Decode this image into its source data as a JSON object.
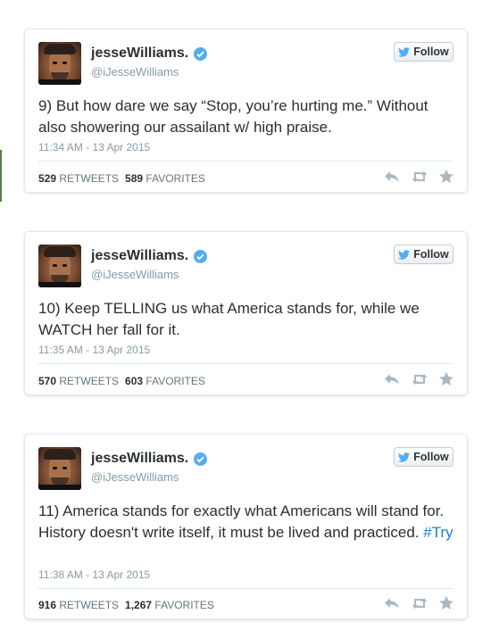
{
  "tweets": [
    {
      "display_name": "jesseWilliams.",
      "handle": "@iJesseWilliams",
      "follow_label": "Follow",
      "text": "9) But how dare we say “Stop, you’re hurting me.” Without also showering our assailant w/ high praise.",
      "hashtag": "",
      "timestamp": "11:34 AM - 13 Apr 2015",
      "retweets": "529",
      "retweets_label": "RETWEETS",
      "favorites": "589",
      "favorites_label": "FAVORITES"
    },
    {
      "display_name": "jesseWilliams.",
      "handle": "@iJesseWilliams",
      "follow_label": "Follow",
      "text": "10) Keep TELLING us what America stands for, while we WATCH her fall for it.",
      "hashtag": "",
      "timestamp": "11:35 AM - 13 Apr 2015",
      "retweets": "570",
      "retweets_label": "RETWEETS",
      "favorites": "603",
      "favorites_label": "FAVORITES"
    },
    {
      "display_name": "jesseWilliams.",
      "handle": "@iJesseWilliams",
      "follow_label": "Follow",
      "text": "11) America stands for exactly what Americans will stand for. History doesn't write itself, it must be lived and practiced. ",
      "hashtag": "#Try",
      "timestamp": "11:38 AM - 13 Apr 2015",
      "retweets": "916",
      "retweets_label": "RETWEETS",
      "favorites": "1,267",
      "favorites_label": "FAVORITES"
    }
  ],
  "colors": {
    "link": "#2b7bb9",
    "verified_badge": "#55acee",
    "muted": "#8899a6",
    "action_icons": "#aab8c2"
  },
  "icons": [
    "verified-badge-icon",
    "twitter-bird-icon",
    "reply-icon",
    "retweet-icon",
    "favorite-star-icon"
  ]
}
